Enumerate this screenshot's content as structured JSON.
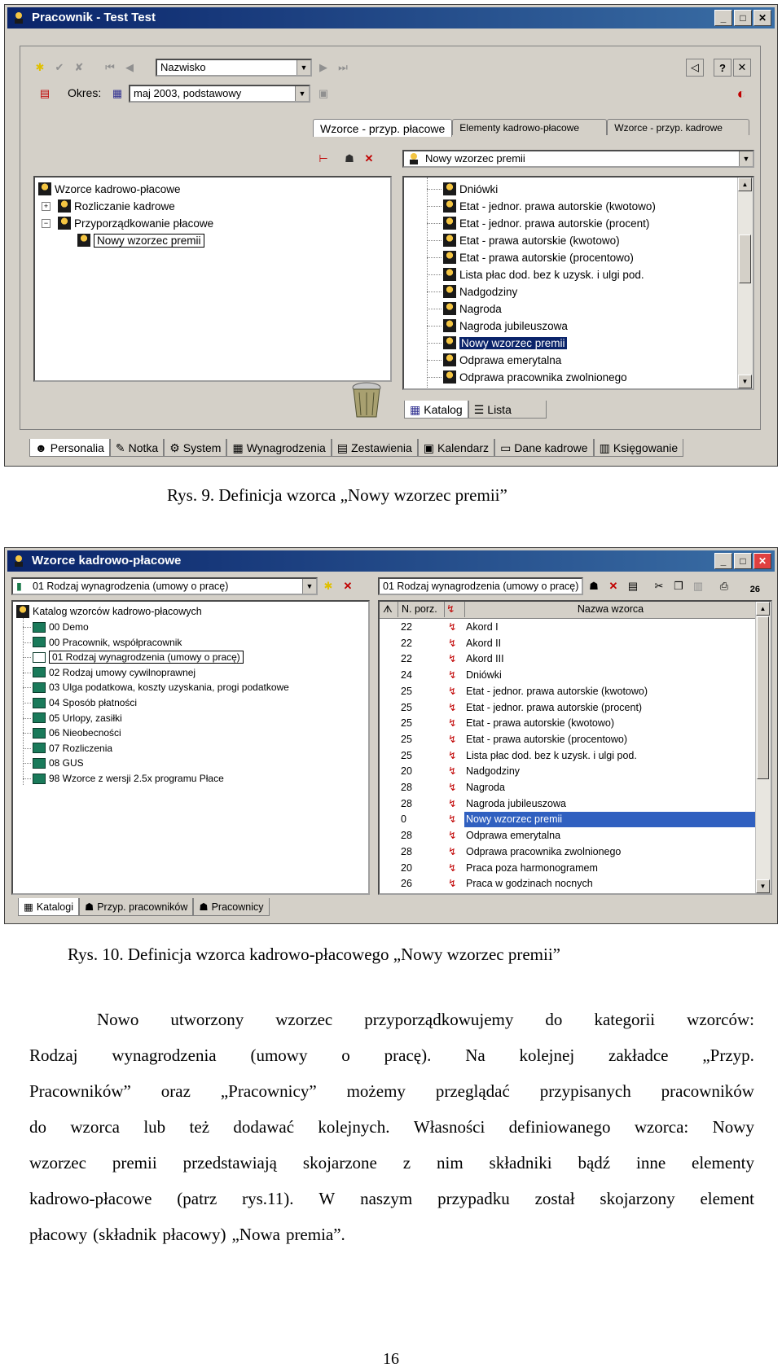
{
  "fig9": {
    "title": "Pracownik - Test Test",
    "sort_combo": "Nazwisko",
    "period_label": "Okres:",
    "period_value": "maj 2003, podstawowy",
    "tabs": [
      "Wzorce - przyp. płacowe",
      "Elementy kadrowo-płacowe",
      "Wzorce - przyp. kadrowe"
    ],
    "right_combo": "Nowy wzorzec premii",
    "tree": [
      "Wzorce kadrowo-płacowe",
      "Rozliczanie kadrowe",
      "Przyporządkowanie płacowe",
      "Nowy wzorzec premii"
    ],
    "list": [
      "Dniówki",
      "Etat - jednor. prawa autorskie (kwotowo)",
      "Etat - jednor. prawa autorskie (procent)",
      "Etat - prawa autorskie (kwotowo)",
      "Etat - prawa autorskie (procentowo)",
      "Lista płac dod. bez k uzysk. i ulgi pod.",
      "Nadgodziny",
      "Nagroda",
      "Nagroda jubileuszowa",
      "Nowy wzorzec premii",
      "Odprawa emerytalna",
      "Odprawa pracownika zwolnionego"
    ],
    "inner_tabs": [
      "Katalog",
      "Lista"
    ],
    "bottom_tabs": [
      "Personalia",
      "Notka",
      "System",
      "Wynagrodzenia",
      "Zestawienia",
      "Kalendarz",
      "Dane kadrowe",
      "Księgowanie"
    ]
  },
  "caption9": "Rys. 9. Definicja wzorca „Nowy wzorzec premii”",
  "fig10": {
    "title": "Wzorce kadrowo-płacowe",
    "left_combo": "01 Rodzaj wynagrodzenia (umowy o pracę)",
    "right_combo": "01 Rodzaj wynagrodzenia (umowy o pracę)",
    "badge": "26",
    "tree_root": "Katalog wzorców kadrowo-płacowych",
    "tree": [
      "00 Demo",
      "00 Pracownik, współpracownik",
      "01 Rodzaj wynagrodzenia (umowy o pracę)",
      "02 Rodzaj umowy cywilnoprawnej",
      "03 Ulga podatkowa, koszty uzyskania, progi podatkowe",
      "04 Sposób płatności",
      "05 Urlopy, zasiłki",
      "06 Nieobecności",
      "07 Rozliczenia",
      "08 GUS",
      "98 Wzorce z wersji 2.5x programu Płace"
    ],
    "col_nr": "N. porz.",
    "col_name": "Nazwa wzorca",
    "rows": [
      {
        "nr": "22",
        "name": "Akord I"
      },
      {
        "nr": "22",
        "name": "Akord II"
      },
      {
        "nr": "22",
        "name": "Akord III"
      },
      {
        "nr": "24",
        "name": "Dniówki"
      },
      {
        "nr": "25",
        "name": "Etat - jednor. prawa autorskie (kwotowo)"
      },
      {
        "nr": "25",
        "name": "Etat - jednor. prawa autorskie (procent)"
      },
      {
        "nr": "25",
        "name": "Etat - prawa autorskie (kwotowo)"
      },
      {
        "nr": "25",
        "name": "Etat - prawa autorskie (procentowo)"
      },
      {
        "nr": "25",
        "name": "Lista płac dod. bez k uzysk. i ulgi pod."
      },
      {
        "nr": "20",
        "name": "Nadgodziny"
      },
      {
        "nr": "28",
        "name": "Nagroda"
      },
      {
        "nr": "28",
        "name": "Nagroda jubileuszowa"
      },
      {
        "nr": "0",
        "name": "Nowy wzorzec premii"
      },
      {
        "nr": "28",
        "name": "Odprawa emerytalna"
      },
      {
        "nr": "28",
        "name": "Odprawa pracownika zwolnionego"
      },
      {
        "nr": "20",
        "name": "Praca poza harmonogramem"
      },
      {
        "nr": "26",
        "name": "Praca w godzinach nocnych"
      }
    ],
    "bottom_tabs": [
      "Katalogi",
      "Przyp. pracowników",
      "Pracownicy"
    ]
  },
  "caption10": "Rys. 10. Definicja wzorca kadrowo-płacowego „Nowy wzorzec premii”",
  "paragraph_lines": [
    [
      "Nowo",
      "utworzony",
      "wzorzec",
      "przyporządkowujemy",
      "do",
      "kategorii",
      "wzorców:"
    ],
    [
      "Rodzaj",
      "wynagrodzenia",
      "(umowy",
      "o",
      "pracę).",
      "Na",
      "kolejnej",
      "zakładce",
      "„Przyp."
    ],
    [
      "Pracowników”",
      "oraz",
      "„Pracownicy”",
      "możemy",
      "przeglądać",
      "przypisanych",
      "pracowników"
    ],
    [
      "do",
      "wzorca",
      "lub",
      "też",
      "dodawać",
      "kolejnych.",
      "Własności",
      "definiowanego",
      "wzorca:",
      "Nowy"
    ],
    [
      "wzorzec",
      "premii",
      "przedstawiają",
      "skojarzone",
      "z",
      "nim",
      "składniki",
      "bądź",
      "inne",
      "elementy"
    ],
    [
      "kadrowo-płacowe",
      "(patrz",
      "rys.11).",
      "W",
      "naszym",
      "przypadku",
      "został",
      "skojarzony",
      "element"
    ],
    [
      "płacowy",
      "(składnik",
      "płacowy)",
      "„Nowa",
      "premia”."
    ]
  ],
  "page_number": "16",
  "colors": {
    "titlebar": "#0a246a",
    "selection": "#0a246a",
    "face": "#d4d0c8"
  }
}
